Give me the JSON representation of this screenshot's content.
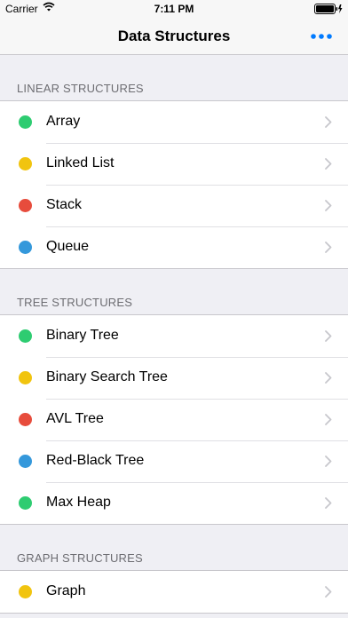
{
  "status_bar": {
    "carrier": "Carrier",
    "time": "7:11 PM",
    "wifi_icon": "wifi-icon",
    "battery_icon": "battery-charging-icon"
  },
  "nav": {
    "title": "Data Structures",
    "more_icon": "more-horizontal-icon",
    "accent_color": "#007aff"
  },
  "sections": [
    {
      "header": "LINEAR STRUCTURES",
      "items": [
        {
          "label": "Array",
          "color": "#2ecc71"
        },
        {
          "label": "Linked List",
          "color": "#f1c40f"
        },
        {
          "label": "Stack",
          "color": "#e74c3c"
        },
        {
          "label": "Queue",
          "color": "#3498db"
        }
      ]
    },
    {
      "header": "TREE STRUCTURES",
      "items": [
        {
          "label": "Binary Tree",
          "color": "#2ecc71"
        },
        {
          "label": "Binary Search Tree",
          "color": "#f1c40f"
        },
        {
          "label": "AVL Tree",
          "color": "#e74c3c"
        },
        {
          "label": "Red-Black Tree",
          "color": "#3498db"
        },
        {
          "label": "Max Heap",
          "color": "#2ecc71"
        }
      ]
    },
    {
      "header": "GRAPH STRUCTURES",
      "items": [
        {
          "label": "Graph",
          "color": "#f1c40f"
        }
      ]
    }
  ]
}
